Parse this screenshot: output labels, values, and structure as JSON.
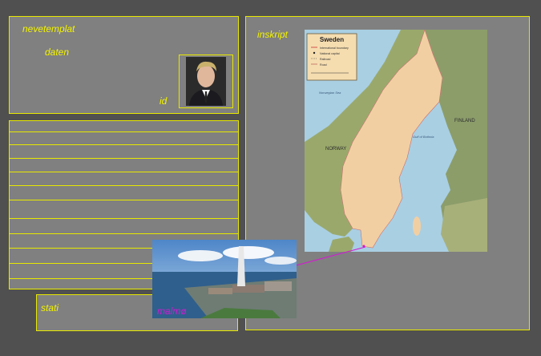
{
  "colors": {
    "background": "#505050",
    "panel": "#808080",
    "border": "#e8e800",
    "label": "#f2f200",
    "link": "#d21ad2"
  },
  "header_panel": {
    "title": "nevetemplat",
    "date_label": "daten",
    "id_label": "id",
    "portrait_icon": "person-portrait-icon"
  },
  "list_panel": {
    "row_count": 12
  },
  "status_panel": {
    "label": "stati"
  },
  "inscription_panel": {
    "label": "inskript",
    "map": {
      "title": "Sweden",
      "legend": [
        "International boundary",
        "National capital",
        "Railroad",
        "Road"
      ],
      "places": [
        "NORWAY",
        "FINLAND",
        "Norwegian Sea",
        "Gulf of Bothnia"
      ]
    }
  },
  "photo": {
    "caption": "malmø",
    "icon": "city-skyline-photo"
  }
}
